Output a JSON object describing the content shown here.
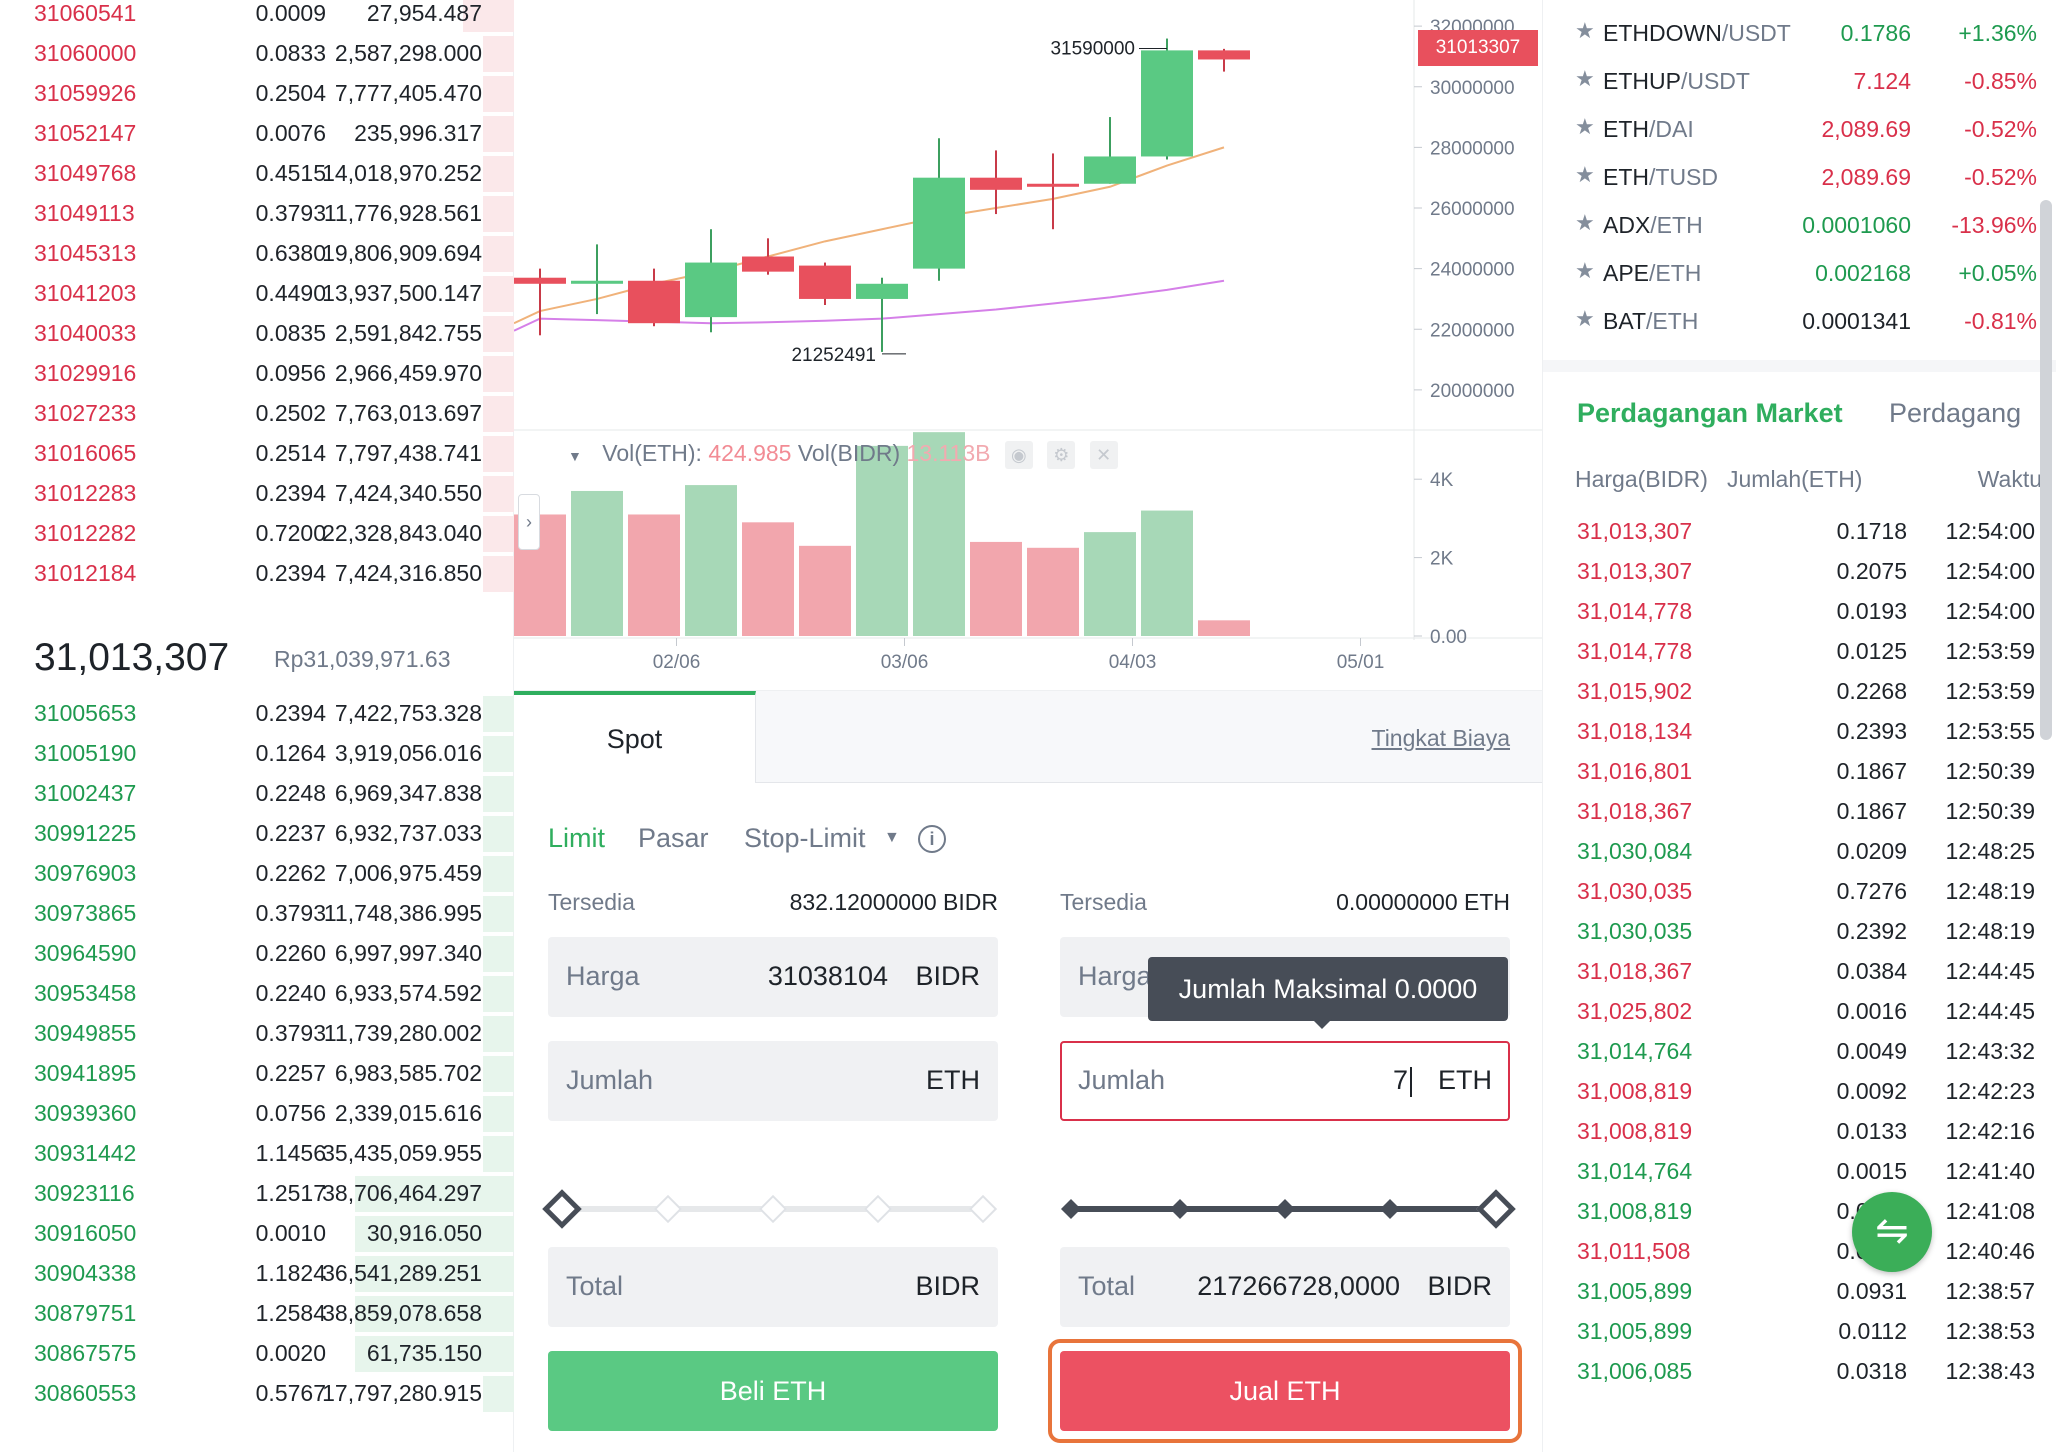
{
  "orderbook": {
    "asks": [
      {
        "price": "31060541",
        "amount": "0.0009",
        "total": "27,954.487",
        "depth": 0.1
      },
      {
        "price": "31060000",
        "amount": "0.0833",
        "total": "2,587,298.000",
        "depth": 0.06
      },
      {
        "price": "31059926",
        "amount": "0.2504",
        "total": "7,777,405.470",
        "depth": 0.06
      },
      {
        "price": "31052147",
        "amount": "0.0076",
        "total": "235,996.317",
        "depth": 0.06
      },
      {
        "price": "31049768",
        "amount": "0.4515",
        "total": "14,018,970.252",
        "depth": 0.06
      },
      {
        "price": "31049113",
        "amount": "0.3793",
        "total": "11,776,928.561",
        "depth": 0.06
      },
      {
        "price": "31045313",
        "amount": "0.6380",
        "total": "19,806,909.694",
        "depth": 0.06
      },
      {
        "price": "31041203",
        "amount": "0.4490",
        "total": "13,937,500.147",
        "depth": 0.06
      },
      {
        "price": "31040033",
        "amount": "0.0835",
        "total": "2,591,842.755",
        "depth": 0.06
      },
      {
        "price": "31029916",
        "amount": "0.0956",
        "total": "2,966,459.970",
        "depth": 0.06
      },
      {
        "price": "31027233",
        "amount": "0.2502",
        "total": "7,763,013.697",
        "depth": 0.06
      },
      {
        "price": "31016065",
        "amount": "0.2514",
        "total": "7,797,438.741",
        "depth": 0.06
      },
      {
        "price": "31012283",
        "amount": "0.2394",
        "total": "7,424,340.550",
        "depth": 0.06
      },
      {
        "price": "31012282",
        "amount": "0.7200",
        "total": "22,328,843.040",
        "depth": 0.06
      },
      {
        "price": "31012184",
        "amount": "0.2394",
        "total": "7,424,316.850",
        "depth": 0.06
      }
    ],
    "last_price": "31,013,307",
    "last_price_fiat": "Rp31,039,971.63",
    "bids": [
      {
        "price": "31005653",
        "amount": "0.2394",
        "total": "7,422,753.328",
        "depth": 0.06
      },
      {
        "price": "31005190",
        "amount": "0.1264",
        "total": "3,919,056.016",
        "depth": 0.06
      },
      {
        "price": "31002437",
        "amount": "0.2248",
        "total": "6,969,347.838",
        "depth": 0.06
      },
      {
        "price": "30991225",
        "amount": "0.2237",
        "total": "6,932,737.033",
        "depth": 0.06
      },
      {
        "price": "30976903",
        "amount": "0.2262",
        "total": "7,006,975.459",
        "depth": 0.06
      },
      {
        "price": "30973865",
        "amount": "0.3793",
        "total": "11,748,386.995",
        "depth": 0.06
      },
      {
        "price": "30964590",
        "amount": "0.2260",
        "total": "6,997,997.340",
        "depth": 0.06
      },
      {
        "price": "30953458",
        "amount": "0.2240",
        "total": "6,933,574.592",
        "depth": 0.06
      },
      {
        "price": "30949855",
        "amount": "0.3793",
        "total": "11,739,280.002",
        "depth": 0.06
      },
      {
        "price": "30941895",
        "amount": "0.2257",
        "total": "6,983,585.702",
        "depth": 0.06
      },
      {
        "price": "30939360",
        "amount": "0.0756",
        "total": "2,339,015.616",
        "depth": 0.06
      },
      {
        "price": "30931442",
        "amount": "1.1456",
        "total": "35,435,059.955",
        "depth": 0.06
      },
      {
        "price": "30923116",
        "amount": "1.2517",
        "total": "38,706,464.297",
        "depth": 0.31
      },
      {
        "price": "30916050",
        "amount": "0.0010",
        "total": "30,916.050",
        "depth": 0.31
      },
      {
        "price": "30904338",
        "amount": "1.1824",
        "total": "36,541,289.251",
        "depth": 0.31
      },
      {
        "price": "30879751",
        "amount": "1.2584",
        "total": "38,859,078.658",
        "depth": 0.31
      },
      {
        "price": "30867575",
        "amount": "0.0020",
        "total": "61,735.150",
        "depth": 0.31
      },
      {
        "price": "30860553",
        "amount": "0.5767",
        "total": "17,797,280.915",
        "depth": 0.06
      }
    ]
  },
  "chart_data": {
    "type": "candlestick",
    "price_axis_ticks": [
      "32000000",
      "30000000",
      "28000000",
      "26000000",
      "24000000",
      "22000000",
      "20000000"
    ],
    "price_range": [
      19600000,
      32400000
    ],
    "volume_axis_ticks": [
      "4K",
      "2K",
      "0.00"
    ],
    "volume_range": [
      0,
      5000
    ],
    "x_ticks": [
      "02/06",
      "03/06",
      "04/03",
      "05/01"
    ],
    "high_label": "31590000",
    "low_label": "21252491",
    "current_price_tag": "31013307",
    "candles": [
      {
        "o": 23700000,
        "c": 23500000,
        "h": 24000000,
        "l": 21800000
      },
      {
        "o": 23500000,
        "c": 23600000,
        "h": 24800000,
        "l": 22500000
      },
      {
        "o": 23600000,
        "c": 22200000,
        "h": 24000000,
        "l": 22100000
      },
      {
        "o": 22400000,
        "c": 24200000,
        "h": 25300000,
        "l": 21900000
      },
      {
        "o": 24400000,
        "c": 23900000,
        "h": 25000000,
        "l": 23800000
      },
      {
        "o": 24100000,
        "c": 23000000,
        "h": 24200000,
        "l": 22800000
      },
      {
        "o": 23000000,
        "c": 23500000,
        "h": 23700000,
        "l": 21252491
      },
      {
        "o": 24000000,
        "c": 27000000,
        "h": 28300000,
        "l": 23600000
      },
      {
        "o": 27000000,
        "c": 26600000,
        "h": 27900000,
        "l": 25800000
      },
      {
        "o": 26800000,
        "c": 26700000,
        "h": 27800000,
        "l": 25300000
      },
      {
        "o": 26800000,
        "c": 27700000,
        "h": 29000000,
        "l": 26800000
      },
      {
        "o": 27700000,
        "c": 31200000,
        "h": 31590000,
        "l": 27600000
      },
      {
        "o": 31200000,
        "c": 30900000,
        "h": 31250000,
        "l": 30500000
      }
    ],
    "ma_short": [
      22600000,
      23000000,
      23500000,
      23900000,
      24400000,
      24900000,
      25300000,
      25700000,
      26000000,
      26300000,
      26700000,
      27400000,
      28000000
    ],
    "ma_long": [
      22350000,
      22300000,
      22250000,
      22200000,
      22230000,
      22280000,
      22350000,
      22500000,
      22650000,
      22850000,
      23050000,
      23300000,
      23600000
    ],
    "ma_short_color": "#f0b27a",
    "ma_long_color": "#d580e8",
    "volumes": [
      3100,
      3700,
      3100,
      3850,
      2900,
      2300,
      4850,
      5200,
      2400,
      2250,
      2650,
      3200,
      400
    ],
    "up_color": "#5ac983",
    "down_color": "#e8505d",
    "vol_up_color": "#a7d8b7",
    "vol_down_color": "#f2a6ad"
  },
  "vol_legend": {
    "label1": "Vol(ETH):",
    "value1": "424.985",
    "label2": "Vol(BIDR)",
    "value2": "13.113B"
  },
  "trade": {
    "tab": "Spot",
    "fee_link": "Tingkat Biaya",
    "order_types": {
      "limit": "Limit",
      "market": "Pasar",
      "stop": "Stop-Limit"
    },
    "buy": {
      "avail_label": "Tersedia",
      "avail_value": "832.12000000 BIDR",
      "price_label": "Harga",
      "price_value": "31038104",
      "price_unit": "BIDR",
      "amount_label": "Jumlah",
      "amount_unit": "ETH",
      "total_label": "Total",
      "total_unit": "BIDR",
      "button": "Beli ETH"
    },
    "sell": {
      "avail_label": "Tersedia",
      "avail_value": "0.00000000 ETH",
      "price_label": "Harga",
      "amount_label": "Jumlah",
      "amount_value": "7",
      "amount_unit": "ETH",
      "total_label": "Total",
      "total_value": "217266728,0000",
      "total_unit": "BIDR",
      "button": "Jual ETH",
      "slider_percent": 100
    },
    "tooltip": "Jumlah Maksimal 0.0000"
  },
  "markets": [
    {
      "base": "ETHDOWN",
      "quote": "/USDT",
      "price": "0.1786",
      "change": "+1.36%",
      "price_color": "green",
      "change_color": "green"
    },
    {
      "base": "ETHUP",
      "quote": "/USDT",
      "price": "7.124",
      "change": "-0.85%",
      "price_color": "red",
      "change_color": "red"
    },
    {
      "base": "ETH",
      "quote": "/DAI",
      "price": "2,089.69",
      "change": "-0.52%",
      "price_color": "red",
      "change_color": "red"
    },
    {
      "base": "ETH",
      "quote": "/TUSD",
      "price": "2,089.69",
      "change": "-0.52%",
      "price_color": "red",
      "change_color": "red"
    },
    {
      "base": "ADX",
      "quote": "/ETH",
      "price": "0.0001060",
      "change": "-13.96%",
      "price_color": "green",
      "change_color": "red"
    },
    {
      "base": "APE",
      "quote": "/ETH",
      "price": "0.002168",
      "change": "+0.05%",
      "price_color": "green",
      "change_color": "green"
    },
    {
      "base": "BAT",
      "quote": "/ETH",
      "price": "0.0001341",
      "change": "-0.81%",
      "price_color": "black",
      "change_color": "red"
    }
  ],
  "trades_panel": {
    "tab_market": "Perdagangan Market",
    "tab_mine": "Perdagang",
    "headers": {
      "price": "Harga(BIDR)",
      "amount": "Jumlah(ETH)",
      "time": "Waktu"
    },
    "rows": [
      {
        "price": "31,013,307",
        "amount": "0.1718",
        "time": "12:54:00",
        "side": "red"
      },
      {
        "price": "31,013,307",
        "amount": "0.2075",
        "time": "12:54:00",
        "side": "red"
      },
      {
        "price": "31,014,778",
        "amount": "0.0193",
        "time": "12:54:00",
        "side": "red"
      },
      {
        "price": "31,014,778",
        "amount": "0.0125",
        "time": "12:53:59",
        "side": "red"
      },
      {
        "price": "31,015,902",
        "amount": "0.2268",
        "time": "12:53:59",
        "side": "red"
      },
      {
        "price": "31,018,134",
        "amount": "0.2393",
        "time": "12:53:55",
        "side": "red"
      },
      {
        "price": "31,016,801",
        "amount": "0.1867",
        "time": "12:50:39",
        "side": "red"
      },
      {
        "price": "31,018,367",
        "amount": "0.1867",
        "time": "12:50:39",
        "side": "red"
      },
      {
        "price": "31,030,084",
        "amount": "0.0209",
        "time": "12:48:25",
        "side": "green"
      },
      {
        "price": "31,030,035",
        "amount": "0.7276",
        "time": "12:48:19",
        "side": "red"
      },
      {
        "price": "31,030,035",
        "amount": "0.2392",
        "time": "12:48:19",
        "side": "green"
      },
      {
        "price": "31,018,367",
        "amount": "0.0384",
        "time": "12:44:45",
        "side": "red"
      },
      {
        "price": "31,025,802",
        "amount": "0.0016",
        "time": "12:44:45",
        "side": "red"
      },
      {
        "price": "31,014,764",
        "amount": "0.0049",
        "time": "12:43:32",
        "side": "green"
      },
      {
        "price": "31,008,819",
        "amount": "0.0092",
        "time": "12:42:23",
        "side": "red"
      },
      {
        "price": "31,008,819",
        "amount": "0.0133",
        "time": "12:42:16",
        "side": "red"
      },
      {
        "price": "31,014,764",
        "amount": "0.0015",
        "time": "12:41:40",
        "side": "green"
      },
      {
        "price": "31,008,819",
        "amount": "0.0008",
        "time": "12:41:08",
        "side": "green"
      },
      {
        "price": "31,011,508",
        "amount": "0.0016",
        "time": "12:40:46",
        "side": "red"
      },
      {
        "price": "31,005,899",
        "amount": "0.0931",
        "time": "12:38:57",
        "side": "green"
      },
      {
        "price": "31,005,899",
        "amount": "0.0112",
        "time": "12:38:53",
        "side": "green"
      },
      {
        "price": "31,006,085",
        "amount": "0.0318",
        "time": "12:38:43",
        "side": "green"
      }
    ]
  }
}
